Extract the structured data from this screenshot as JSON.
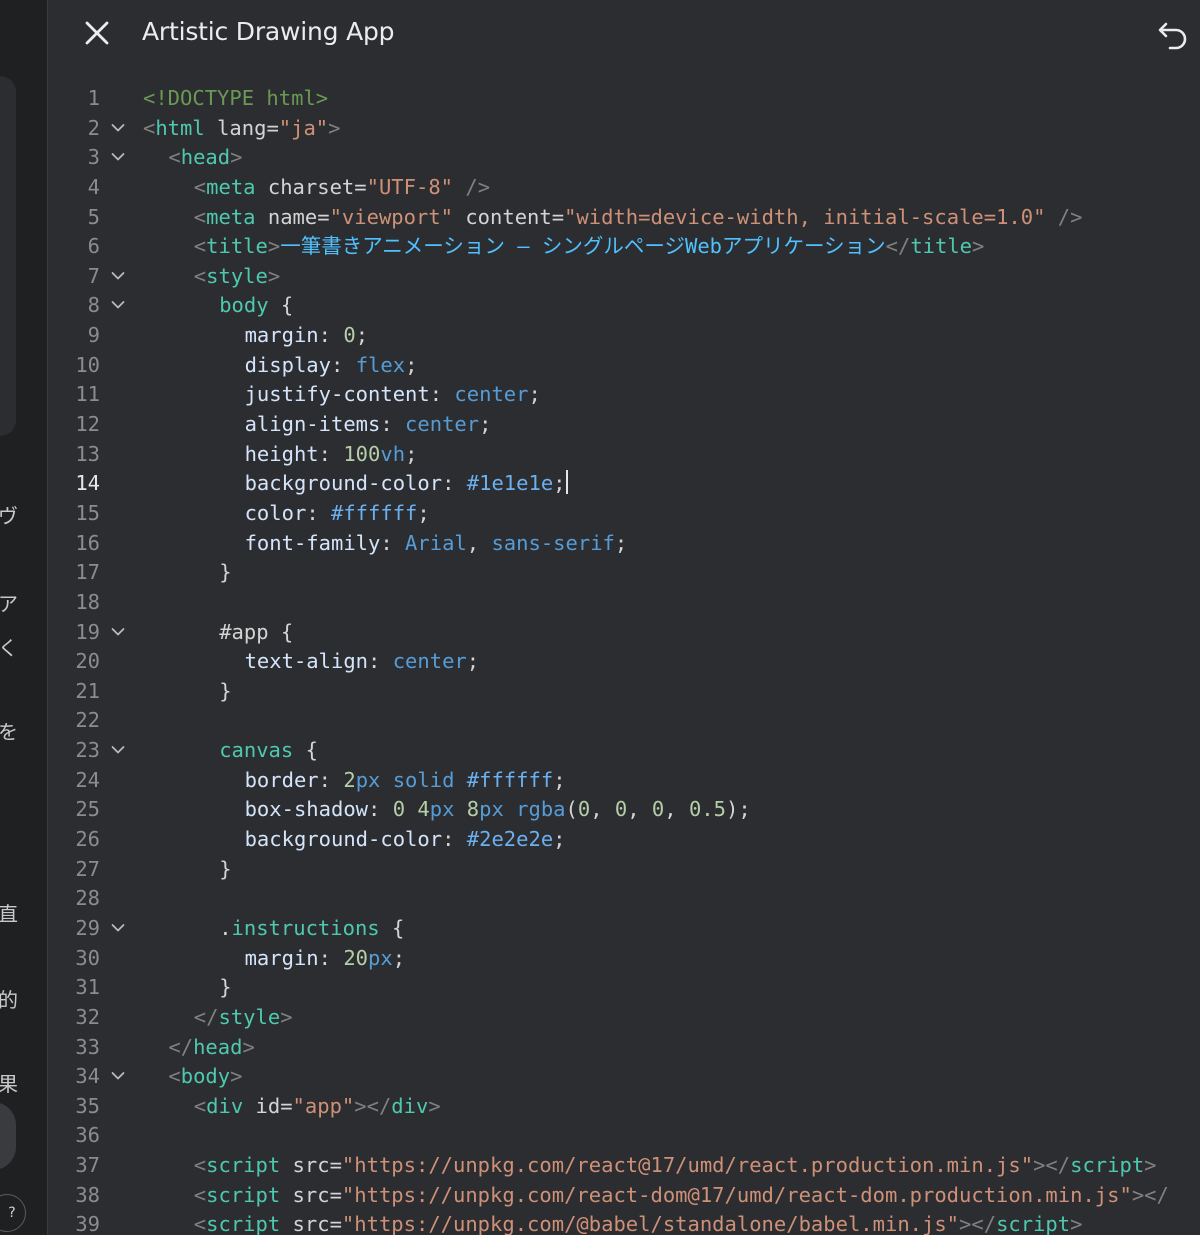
{
  "header": {
    "title": "Artistic Drawing App",
    "close_icon": "close-icon",
    "undo_icon": "undo-icon"
  },
  "left_strip": {
    "fragments": [
      "ヴ",
      "ア",
      "く",
      "を",
      "直",
      "的",
      "果"
    ],
    "help_label": "?"
  },
  "editor": {
    "active_line": 14,
    "lines": [
      {
        "n": "1",
        "fold": false,
        "indent": 0,
        "tokens": [
          [
            "doc",
            "<!DOCTYPE html>"
          ]
        ]
      },
      {
        "n": "2",
        "fold": true,
        "indent": 0,
        "tokens": [
          [
            "br",
            "<"
          ],
          [
            "tag",
            "html"
          ],
          [
            "p",
            " "
          ],
          [
            "attr",
            "lang"
          ],
          [
            "p",
            "="
          ],
          [
            "str",
            "\"ja\""
          ],
          [
            "br",
            ">"
          ]
        ]
      },
      {
        "n": "3",
        "fold": true,
        "indent": 1,
        "tokens": [
          [
            "br",
            "<"
          ],
          [
            "tag",
            "head"
          ],
          [
            "br",
            ">"
          ]
        ]
      },
      {
        "n": "4",
        "fold": false,
        "indent": 2,
        "tokens": [
          [
            "br",
            "<"
          ],
          [
            "tag",
            "meta"
          ],
          [
            "p",
            " "
          ],
          [
            "attr",
            "charset"
          ],
          [
            "p",
            "="
          ],
          [
            "str",
            "\"UTF-8\""
          ],
          [
            "p",
            " "
          ],
          [
            "br",
            "/>"
          ]
        ]
      },
      {
        "n": "5",
        "fold": false,
        "indent": 2,
        "tokens": [
          [
            "br",
            "<"
          ],
          [
            "tag",
            "meta"
          ],
          [
            "p",
            " "
          ],
          [
            "attr",
            "name"
          ],
          [
            "p",
            "="
          ],
          [
            "str",
            "\"viewport\""
          ],
          [
            "p",
            " "
          ],
          [
            "attr",
            "content"
          ],
          [
            "p",
            "="
          ],
          [
            "str",
            "\"width=device-width, initial-scale=1.0\""
          ],
          [
            "p",
            " "
          ],
          [
            "br",
            "/>"
          ]
        ]
      },
      {
        "n": "6",
        "fold": false,
        "indent": 2,
        "tokens": [
          [
            "br",
            "<"
          ],
          [
            "tag",
            "title"
          ],
          [
            "br",
            ">"
          ],
          [
            "txt",
            "一筆書きアニメーション – シングルページWebアプリケーション"
          ],
          [
            "br",
            "</"
          ],
          [
            "tag",
            "title"
          ],
          [
            "br",
            ">"
          ]
        ]
      },
      {
        "n": "7",
        "fold": true,
        "indent": 2,
        "tokens": [
          [
            "br",
            "<"
          ],
          [
            "tag",
            "style"
          ],
          [
            "br",
            ">"
          ]
        ]
      },
      {
        "n": "8",
        "fold": true,
        "indent": 3,
        "tokens": [
          [
            "sel",
            "body"
          ],
          [
            "p",
            " {"
          ]
        ]
      },
      {
        "n": "9",
        "fold": false,
        "indent": 4,
        "tokens": [
          [
            "prop2",
            "margin"
          ],
          [
            "p",
            ": "
          ],
          [
            "num",
            "0"
          ],
          [
            "p",
            ";"
          ]
        ]
      },
      {
        "n": "10",
        "fold": false,
        "indent": 4,
        "tokens": [
          [
            "prop2",
            "display"
          ],
          [
            "p",
            ": "
          ],
          [
            "val",
            "flex"
          ],
          [
            "p",
            ";"
          ]
        ]
      },
      {
        "n": "11",
        "fold": false,
        "indent": 4,
        "tokens": [
          [
            "prop2",
            "justify-content"
          ],
          [
            "p",
            ": "
          ],
          [
            "val",
            "center"
          ],
          [
            "p",
            ";"
          ]
        ]
      },
      {
        "n": "12",
        "fold": false,
        "indent": 4,
        "tokens": [
          [
            "prop2",
            "align-items"
          ],
          [
            "p",
            ": "
          ],
          [
            "val",
            "center"
          ],
          [
            "p",
            ";"
          ]
        ]
      },
      {
        "n": "13",
        "fold": false,
        "indent": 4,
        "tokens": [
          [
            "prop2",
            "height"
          ],
          [
            "p",
            ": "
          ],
          [
            "num",
            "100"
          ],
          [
            "val",
            "vh"
          ],
          [
            "p",
            ";"
          ]
        ]
      },
      {
        "n": "14",
        "fold": false,
        "indent": 4,
        "caret": true,
        "tokens": [
          [
            "prop2",
            "background-color"
          ],
          [
            "p",
            ": "
          ],
          [
            "hex",
            "#1e1e1e"
          ],
          [
            "p",
            ";"
          ]
        ]
      },
      {
        "n": "15",
        "fold": false,
        "indent": 4,
        "tokens": [
          [
            "prop2",
            "color"
          ],
          [
            "p",
            ": "
          ],
          [
            "hex",
            "#ffffff"
          ],
          [
            "p",
            ";"
          ]
        ]
      },
      {
        "n": "16",
        "fold": false,
        "indent": 4,
        "tokens": [
          [
            "prop2",
            "font-family"
          ],
          [
            "p",
            ": "
          ],
          [
            "val",
            "Arial"
          ],
          [
            "p",
            ", "
          ],
          [
            "val",
            "sans-serif"
          ],
          [
            "p",
            ";"
          ]
        ]
      },
      {
        "n": "17",
        "fold": false,
        "indent": 3,
        "tokens": [
          [
            "p",
            "}"
          ]
        ]
      },
      {
        "n": "18",
        "fold": false,
        "indent": 0,
        "tokens": []
      },
      {
        "n": "19",
        "fold": true,
        "indent": 3,
        "tokens": [
          [
            "p",
            "#app {"
          ]
        ]
      },
      {
        "n": "20",
        "fold": false,
        "indent": 4,
        "tokens": [
          [
            "prop2",
            "text-align"
          ],
          [
            "p",
            ": "
          ],
          [
            "val",
            "center"
          ],
          [
            "p",
            ";"
          ]
        ]
      },
      {
        "n": "21",
        "fold": false,
        "indent": 3,
        "tokens": [
          [
            "p",
            "}"
          ]
        ]
      },
      {
        "n": "22",
        "fold": false,
        "indent": 0,
        "tokens": []
      },
      {
        "n": "23",
        "fold": true,
        "indent": 3,
        "tokens": [
          [
            "sel",
            "canvas"
          ],
          [
            "p",
            " {"
          ]
        ]
      },
      {
        "n": "24",
        "fold": false,
        "indent": 4,
        "tokens": [
          [
            "prop2",
            "border"
          ],
          [
            "p",
            ": "
          ],
          [
            "num",
            "2"
          ],
          [
            "val",
            "px"
          ],
          [
            "p",
            " "
          ],
          [
            "val",
            "solid"
          ],
          [
            "p",
            " "
          ],
          [
            "hex",
            "#ffffff"
          ],
          [
            "p",
            ";"
          ]
        ]
      },
      {
        "n": "25",
        "fold": false,
        "indent": 4,
        "tokens": [
          [
            "prop2",
            "box-shadow"
          ],
          [
            "p",
            ": "
          ],
          [
            "num",
            "0"
          ],
          [
            "p",
            " "
          ],
          [
            "num",
            "4"
          ],
          [
            "val",
            "px"
          ],
          [
            "p",
            " "
          ],
          [
            "num",
            "8"
          ],
          [
            "val",
            "px"
          ],
          [
            "p",
            " "
          ],
          [
            "val",
            "rgba"
          ],
          [
            "p",
            "("
          ],
          [
            "num",
            "0"
          ],
          [
            "p",
            ", "
          ],
          [
            "num",
            "0"
          ],
          [
            "p",
            ", "
          ],
          [
            "num",
            "0"
          ],
          [
            "p",
            ", "
          ],
          [
            "num",
            "0.5"
          ],
          [
            "p",
            ");"
          ]
        ]
      },
      {
        "n": "26",
        "fold": false,
        "indent": 4,
        "tokens": [
          [
            "prop2",
            "background-color"
          ],
          [
            "p",
            ": "
          ],
          [
            "hex",
            "#2e2e2e"
          ],
          [
            "p",
            ";"
          ]
        ]
      },
      {
        "n": "27",
        "fold": false,
        "indent": 3,
        "tokens": [
          [
            "p",
            "}"
          ]
        ]
      },
      {
        "n": "28",
        "fold": false,
        "indent": 0,
        "tokens": []
      },
      {
        "n": "29",
        "fold": true,
        "indent": 3,
        "tokens": [
          [
            "p",
            "."
          ],
          [
            "sel",
            "instructions"
          ],
          [
            "p",
            " {"
          ]
        ]
      },
      {
        "n": "30",
        "fold": false,
        "indent": 4,
        "tokens": [
          [
            "prop2",
            "margin"
          ],
          [
            "p",
            ": "
          ],
          [
            "num",
            "20"
          ],
          [
            "val",
            "px"
          ],
          [
            "p",
            ";"
          ]
        ]
      },
      {
        "n": "31",
        "fold": false,
        "indent": 3,
        "tokens": [
          [
            "p",
            "}"
          ]
        ]
      },
      {
        "n": "32",
        "fold": false,
        "indent": 2,
        "tokens": [
          [
            "br",
            "</"
          ],
          [
            "tag",
            "style"
          ],
          [
            "br",
            ">"
          ]
        ]
      },
      {
        "n": "33",
        "fold": false,
        "indent": 1,
        "tokens": [
          [
            "br",
            "</"
          ],
          [
            "tag",
            "head"
          ],
          [
            "br",
            ">"
          ]
        ]
      },
      {
        "n": "34",
        "fold": true,
        "indent": 1,
        "tokens": [
          [
            "br",
            "<"
          ],
          [
            "tag",
            "body"
          ],
          [
            "br",
            ">"
          ]
        ]
      },
      {
        "n": "35",
        "fold": false,
        "indent": 2,
        "tokens": [
          [
            "br",
            "<"
          ],
          [
            "tag",
            "div"
          ],
          [
            "p",
            " "
          ],
          [
            "attr",
            "id"
          ],
          [
            "p",
            "="
          ],
          [
            "str",
            "\"app\""
          ],
          [
            "br",
            "></"
          ],
          [
            "tag",
            "div"
          ],
          [
            "br",
            ">"
          ]
        ]
      },
      {
        "n": "36",
        "fold": false,
        "indent": 0,
        "tokens": []
      },
      {
        "n": "37",
        "fold": false,
        "indent": 2,
        "tokens": [
          [
            "br",
            "<"
          ],
          [
            "tag",
            "script"
          ],
          [
            "p",
            " "
          ],
          [
            "attr",
            "src"
          ],
          [
            "p",
            "="
          ],
          [
            "str",
            "\"https://unpkg.com/react@17/umd/react.production.min.js\""
          ],
          [
            "br",
            "></"
          ],
          [
            "tag",
            "script"
          ],
          [
            "br",
            ">"
          ]
        ]
      },
      {
        "n": "38",
        "fold": false,
        "indent": 2,
        "tokens": [
          [
            "br",
            "<"
          ],
          [
            "tag",
            "script"
          ],
          [
            "p",
            " "
          ],
          [
            "attr",
            "src"
          ],
          [
            "p",
            "="
          ],
          [
            "str",
            "\"https://unpkg.com/react-dom@17/umd/react-dom.production.min.js\""
          ],
          [
            "br",
            "></"
          ]
        ]
      },
      {
        "n": "39",
        "fold": false,
        "indent": 2,
        "tokens": [
          [
            "br",
            "<"
          ],
          [
            "tag",
            "script"
          ],
          [
            "p",
            " "
          ],
          [
            "attr",
            "src"
          ],
          [
            "p",
            "="
          ],
          [
            "str",
            "\"https://unpkg.com/@babel/standalone/babel.min.js\""
          ],
          [
            "br",
            "></"
          ],
          [
            "tag",
            "script"
          ],
          [
            "br",
            ">"
          ]
        ]
      }
    ]
  }
}
